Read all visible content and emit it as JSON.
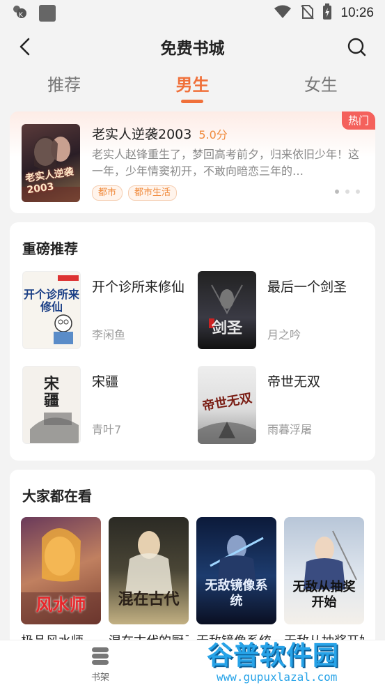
{
  "status": {
    "time": "10:26"
  },
  "header": {
    "title": "免费书城"
  },
  "tabs": [
    {
      "label": "推荐"
    },
    {
      "label": "男生"
    },
    {
      "label": "女生"
    }
  ],
  "hot": {
    "badge": "热门",
    "title": "老实人逆袭2003",
    "score": "5.0分",
    "description": "老实人赵锋重生了，梦回高考前夕，归来依旧少年！这一年，少年情窦初开，不敢向暗恋三年的…",
    "cover_text": "老实人逆袭2003",
    "tags": [
      "都市",
      "都市生活"
    ]
  },
  "featured": {
    "title": "重磅推荐",
    "books": [
      {
        "title": "开个诊所来修仙",
        "author": "李闲鱼",
        "cover_text": "开个诊所来修仙"
      },
      {
        "title": "最后一个剑圣",
        "author": "月之吟",
        "cover_text": "剑圣"
      },
      {
        "title": "宋疆",
        "author": "青叶7",
        "cover_text": "宋疆"
      },
      {
        "title": "帝世无双",
        "author": "雨暮浮屠",
        "cover_text": "帝世无双"
      }
    ]
  },
  "popular": {
    "title": "大家都在看",
    "books": [
      {
        "title": "极品风水师",
        "cover_text": "风水师"
      },
      {
        "title": "混在古代的厨子",
        "cover_text": "混在古代"
      },
      {
        "title": "无敌镜像系统",
        "cover_text": "无敌镜像系统"
      },
      {
        "title": "无敌从抽奖开始",
        "cover_text": "无敌从抽奖开始"
      }
    ]
  },
  "bottom_nav": {
    "bookshelf_label": "书架"
  },
  "watermark": {
    "main": "谷普软件园",
    "sub": "www.gupuxlazal.com"
  },
  "colors": {
    "accent": "#f0703a",
    "hot_badge": "#f4615c",
    "score": "#f08a3c"
  }
}
